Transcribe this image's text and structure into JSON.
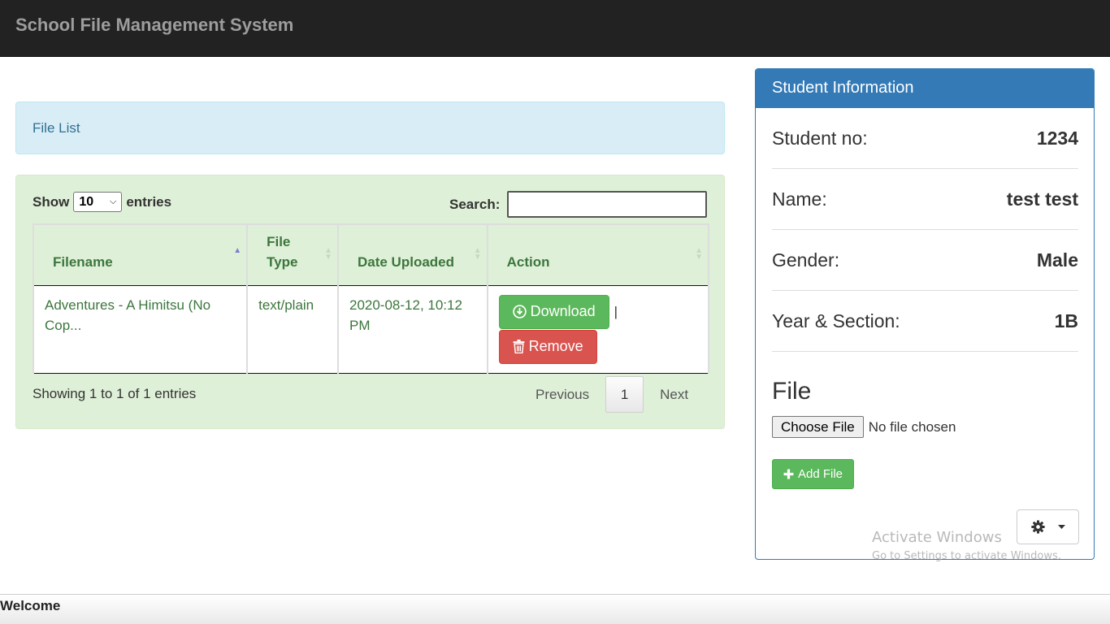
{
  "navbar": {
    "brand": "School File Management System"
  },
  "file_list": {
    "title": "File List"
  },
  "table_controls": {
    "show_label": "Show",
    "entries_value": "10",
    "entries_label": "entries",
    "search_label": "Search:",
    "search_value": ""
  },
  "table": {
    "columns": [
      {
        "line1": "Filename",
        "line2": ""
      },
      {
        "line1": "File",
        "line2": "Type"
      },
      {
        "line1": "Date Uploaded",
        "line2": ""
      },
      {
        "line1": "Action",
        "line2": ""
      }
    ],
    "sorted_column": "Filename",
    "rows": [
      {
        "filename": "Adventures - A Himitsu (No Cop...",
        "file_type": "text/plain",
        "date_uploaded": "2020-08-12, 10:12 PM",
        "download_label": "Download",
        "separator": "|",
        "remove_label": "Remove"
      }
    ]
  },
  "pagination": {
    "info": "Showing 1 to 1 of 1 entries",
    "previous": "Previous",
    "current_page": "1",
    "next": "Next"
  },
  "student_info": {
    "heading": "Student Information",
    "fields": [
      {
        "label": "Student no:",
        "value": "1234"
      },
      {
        "label": "Name:",
        "value": "test test"
      },
      {
        "label": "Gender:",
        "value": "Male"
      },
      {
        "label": "Year & Section:",
        "value": "1B"
      }
    ],
    "file_title": "File",
    "choose_file_label": "Choose File",
    "file_status": "No file chosen",
    "add_file_label": "Add File",
    "settings_icon": "gear-icon"
  },
  "watermark": {
    "line1": "Activate Windows",
    "line2": "Go to Settings to activate Windows."
  },
  "footer": {
    "text": "Welcome"
  },
  "colors": {
    "navbar_bg": "#222222",
    "primary": "#337ab7",
    "success": "#5cb85c",
    "danger": "#d9534f",
    "info_bg": "#d9edf7",
    "success_bg": "#dff0d8"
  }
}
